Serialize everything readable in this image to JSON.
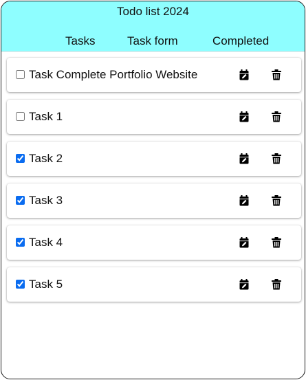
{
  "app": {
    "title": "Todo list 2024"
  },
  "nav": [
    {
      "label": "Tasks"
    },
    {
      "label": "Task form"
    },
    {
      "label": "Completed"
    }
  ],
  "tasks": [
    {
      "title": "Task Complete Portfolio Website",
      "completed": false
    },
    {
      "title": " Task 1",
      "completed": false
    },
    {
      "title": "Task 2",
      "completed": true
    },
    {
      "title": "Task 3",
      "completed": true
    },
    {
      "title": "Task 4",
      "completed": true
    },
    {
      "title": "Task 5",
      "completed": true
    }
  ],
  "icons": {
    "edit": "calendar-edit-icon",
    "delete": "trash-icon"
  },
  "colors": {
    "header": "#8efeff",
    "checkbox": "#0a6cf0"
  }
}
